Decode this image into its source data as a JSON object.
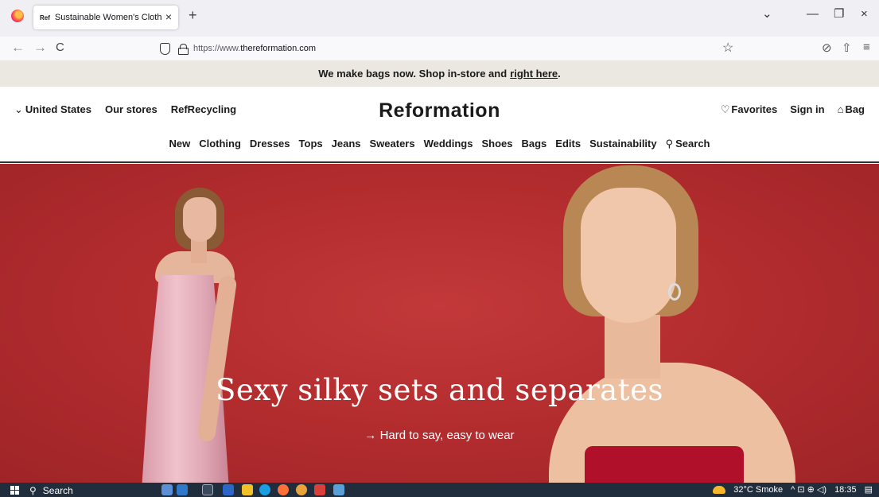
{
  "browser": {
    "tab_favicon": "Ref",
    "tab_title": "Sustainable Women's Clothing",
    "tab_close": "×",
    "new_tab": "+",
    "window_controls": {
      "dropdown": "⌄",
      "minimize": "—",
      "maximize": "❐",
      "close": "×"
    },
    "nav": {
      "back": "←",
      "forward": "→",
      "reload": "C"
    },
    "url_prefix": "https://www.",
    "url_domain": "thereformation.com",
    "star": "☆",
    "toolbar_icons": {
      "pocket": "⊘",
      "share": "⇧",
      "menu": "≡"
    }
  },
  "promo": {
    "text": "We make bags now. Shop in-store and",
    "link": "right here",
    "suffix": "."
  },
  "header": {
    "country": "United States",
    "country_chevron": "⌄",
    "stores": "Our stores",
    "recycling": "RefRecycling",
    "brand": "Reformation",
    "favorites": "Favorites",
    "favorites_icon": "♡",
    "signin": "Sign in",
    "bag": "Bag",
    "bag_icon": "⌂",
    "nav_items": [
      "New",
      "Clothing",
      "Dresses",
      "Tops",
      "Jeans",
      "Sweaters",
      "Weddings",
      "Shoes",
      "Bags",
      "Edits",
      "Sustainability"
    ],
    "search": "Search",
    "search_icon": "⚲"
  },
  "hero": {
    "title": "Sexy silky sets and separates",
    "cta": "→ Hard to say, easy to wear",
    "bg_color": "#b42d2f"
  },
  "taskbar": {
    "search": "Search",
    "search_icon": "⚲",
    "weather": "32°C  Smoke",
    "tray_icons": "^ ⊡ ⊕ ◁)",
    "time": "18:35",
    "notif_icon": "▤"
  }
}
